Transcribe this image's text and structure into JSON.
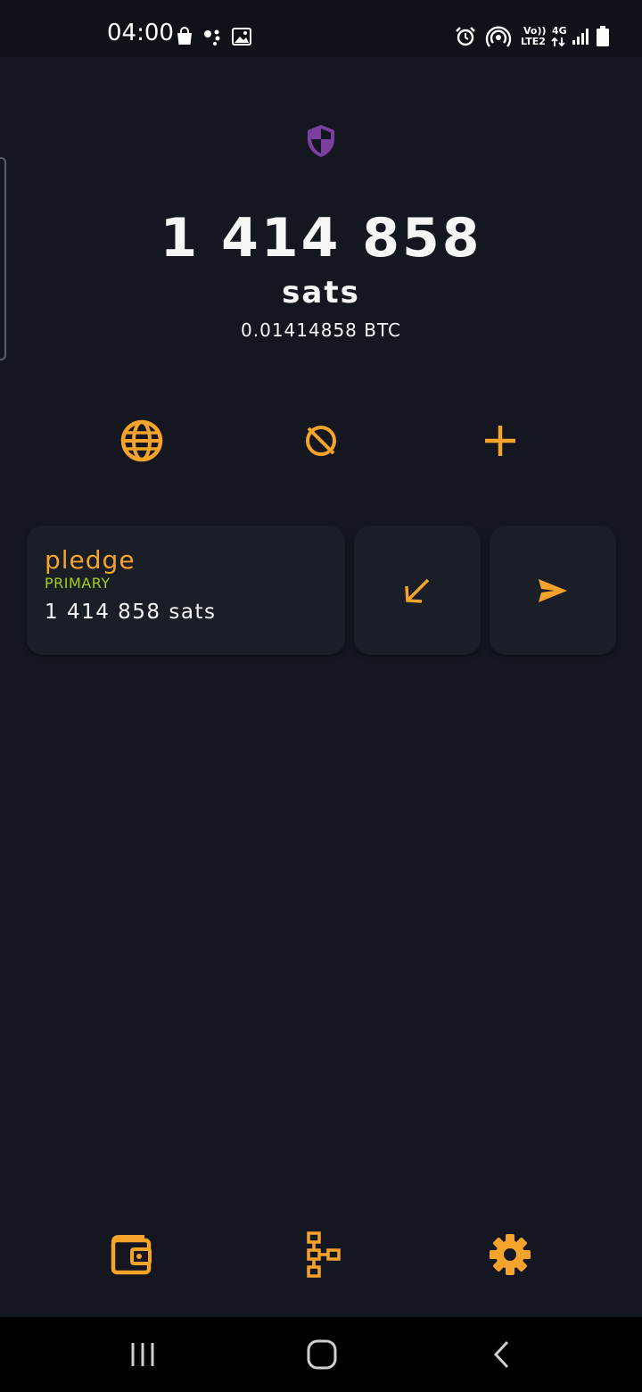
{
  "status_bar": {
    "time": "04:00",
    "network_line1": "Vo))",
    "network_line2": "LTE2",
    "network_type": "4G",
    "icons": [
      "shopping-bag-icon",
      "assistant-dots-icon",
      "image-icon",
      "alarm-icon",
      "hotspot-icon",
      "signal-icon",
      "battery-icon"
    ]
  },
  "balance": {
    "amount": "1 414 858",
    "unit": "sats",
    "btc": "0.01414858 BTC",
    "privacy_icon": "shield-icon"
  },
  "actions": [
    {
      "name": "globe-icon"
    },
    {
      "name": "eye-off-icon"
    },
    {
      "name": "plus-icon"
    }
  ],
  "wallet": {
    "name": "pledge",
    "badge": "PRIMARY",
    "balance": "1 414 858 sats"
  },
  "wallet_actions": {
    "receive_icon": "arrow-down-left-icon",
    "send_icon": "send-icon"
  },
  "bottom_nav": [
    {
      "name": "wallet-icon"
    },
    {
      "name": "tree-icon"
    },
    {
      "name": "gear-icon"
    }
  ],
  "colors": {
    "background": "#141720",
    "card": "#1a1e27",
    "accent": "#f5a32a",
    "badge": "#9fd21a",
    "shield": "#7b3fa0"
  }
}
